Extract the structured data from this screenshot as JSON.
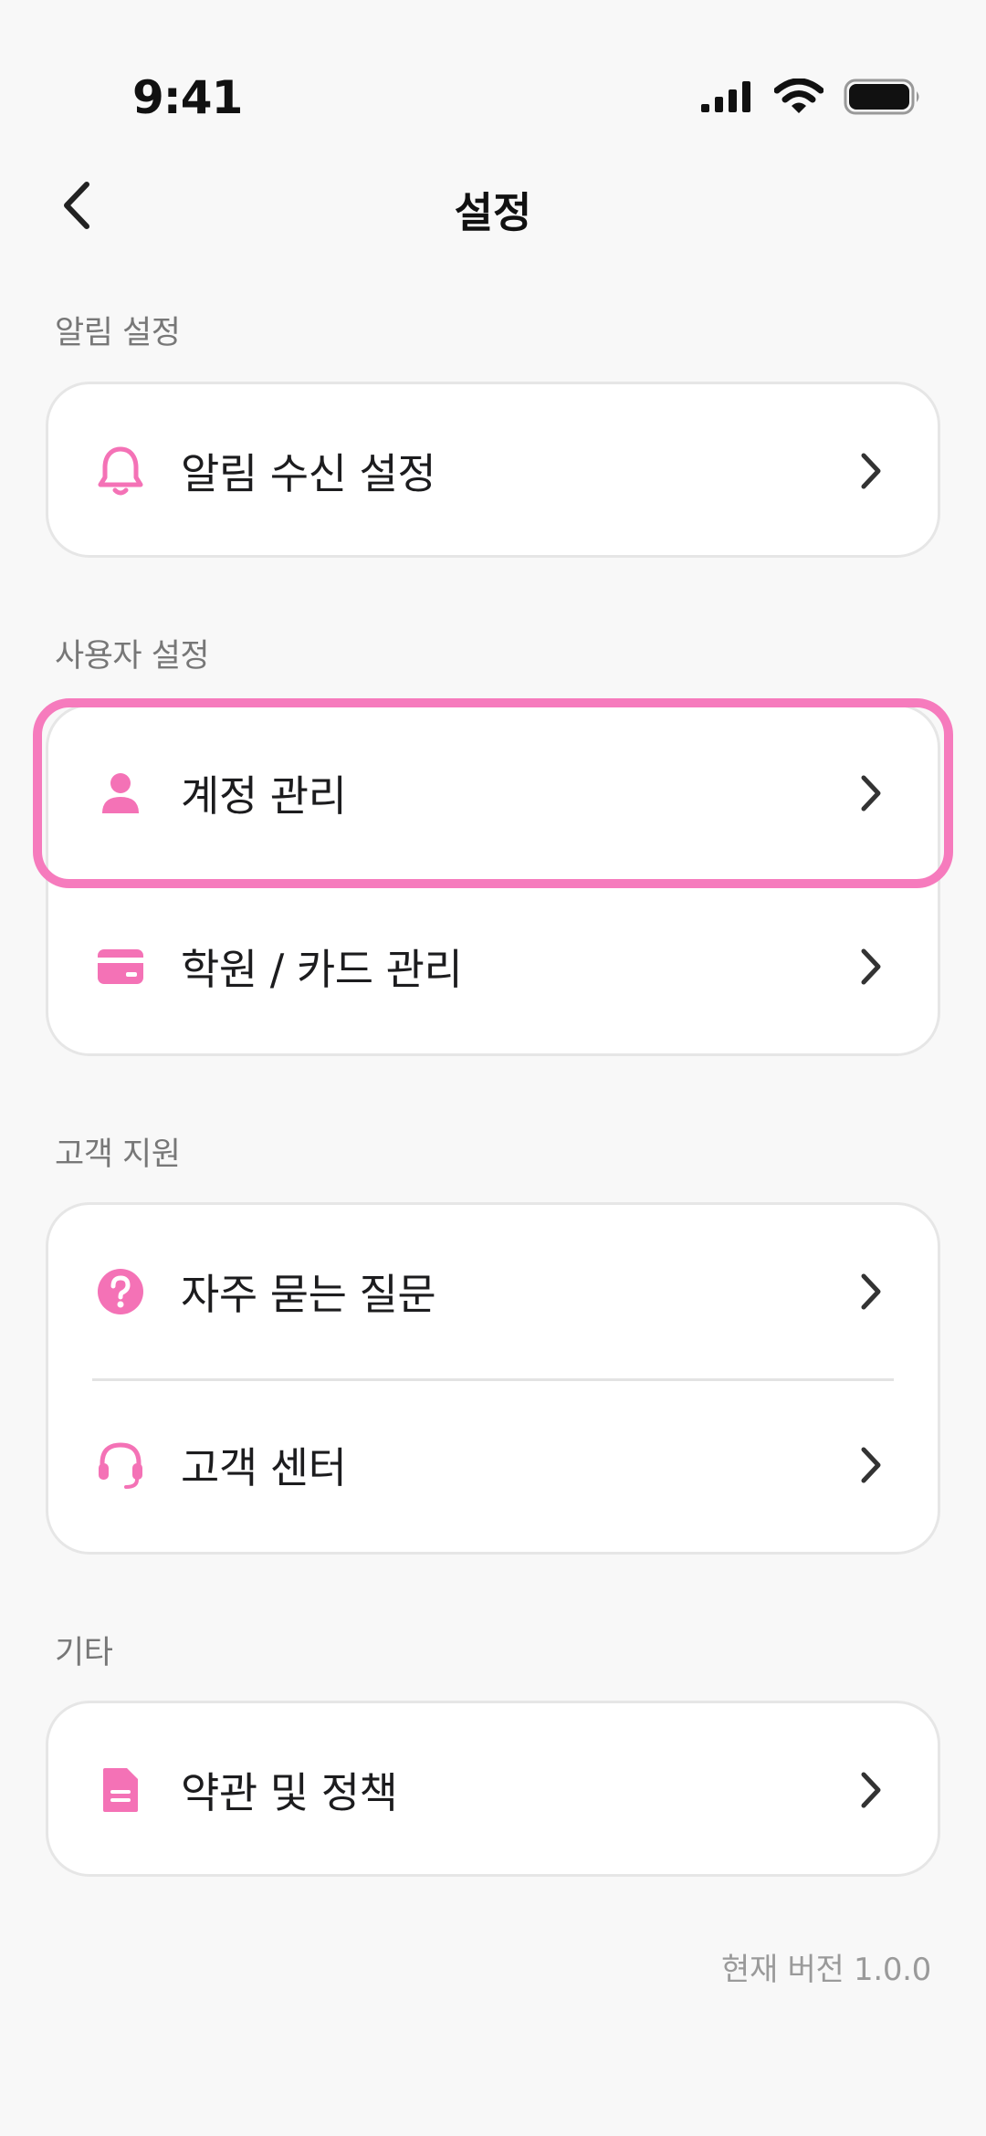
{
  "status_bar": {
    "time": "9:41"
  },
  "nav": {
    "title": "설정"
  },
  "sections": {
    "notifications": {
      "label": "알림 설정",
      "items": [
        {
          "label": "알림 수신 설정",
          "icon": "bell-icon"
        }
      ]
    },
    "user": {
      "label": "사용자 설정",
      "items": [
        {
          "label": "계정 관리",
          "icon": "person-icon"
        },
        {
          "label": "학원 / 카드 관리",
          "icon": "card-icon"
        }
      ]
    },
    "support": {
      "label": "고객 지원",
      "items": [
        {
          "label": "자주 묻는 질문",
          "icon": "question-icon"
        },
        {
          "label": "고객 센터",
          "icon": "headset-icon"
        }
      ]
    },
    "etc": {
      "label": "기타",
      "items": [
        {
          "label": "약관 및 정책",
          "icon": "document-icon"
        }
      ]
    }
  },
  "footer": {
    "version": "현재 버전 1.0.0"
  },
  "colors": {
    "accent": "#f67bbd",
    "icon_pink": "#f472b6",
    "background": "#f8f8f8"
  }
}
